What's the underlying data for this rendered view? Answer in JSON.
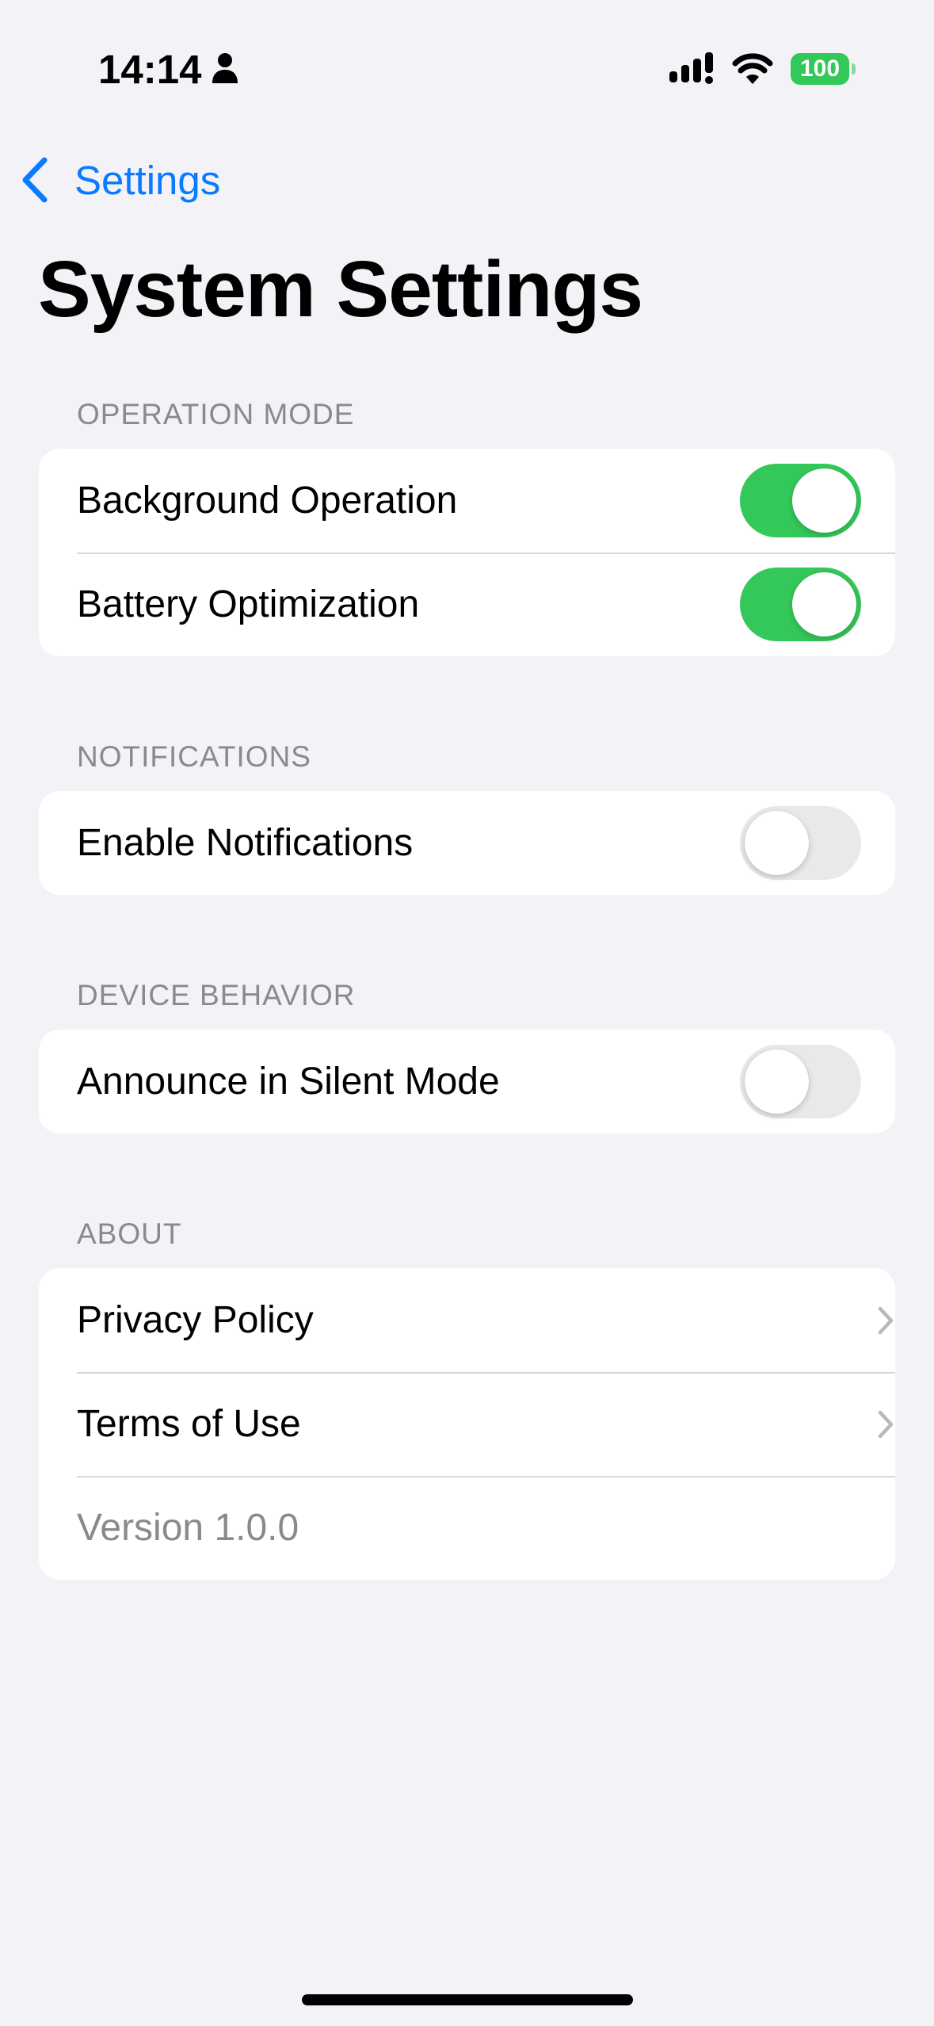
{
  "status_bar": {
    "time": "14:14",
    "battery_level": "100",
    "battery_color": "#34c759"
  },
  "nav": {
    "back_label": "Settings",
    "back_icon": "chevron-left-icon"
  },
  "page": {
    "title": "System Settings"
  },
  "colors": {
    "accent": "#0a7aff",
    "toggle_on": "#34c759",
    "toggle_off": "#e9e9eb",
    "background": "#f2f2f7"
  },
  "sections": {
    "operation_mode": {
      "header": "OPERATION MODE",
      "background_operation": {
        "label": "Background Operation",
        "enabled": true
      },
      "battery_optimization": {
        "label": "Battery Optimization",
        "enabled": true
      }
    },
    "notifications": {
      "header": "NOTIFICATIONS",
      "enable_notifications": {
        "label": "Enable Notifications",
        "enabled": false
      }
    },
    "device_behavior": {
      "header": "DEVICE BEHAVIOR",
      "announce_silent": {
        "label": "Announce in Silent Mode",
        "enabled": false
      }
    },
    "about": {
      "header": "ABOUT",
      "privacy_policy": "Privacy Policy",
      "terms_of_use": "Terms of Use",
      "version": "Version 1.0.0"
    }
  }
}
